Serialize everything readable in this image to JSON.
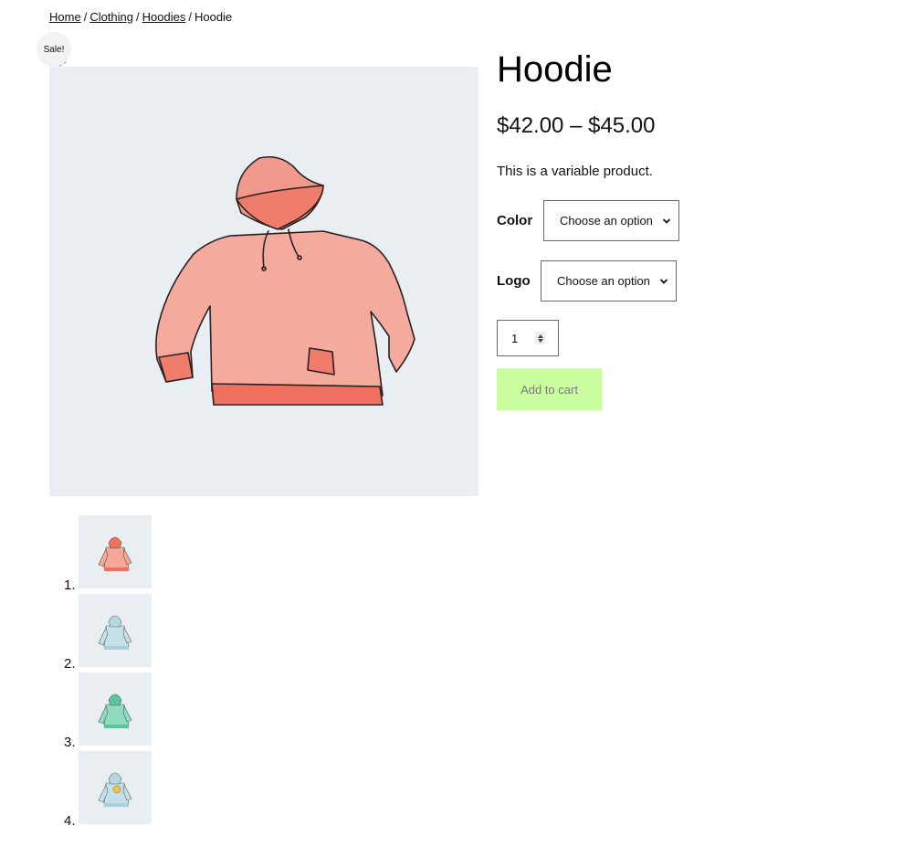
{
  "breadcrumb": {
    "items": [
      {
        "label": "Home",
        "link": true
      },
      {
        "label": "Clothing",
        "link": true
      },
      {
        "label": "Hoodies",
        "link": true
      },
      {
        "label": "Hoodie",
        "link": false
      }
    ],
    "separator": "/"
  },
  "badge": {
    "sale_label": "Sale!"
  },
  "gallery": {
    "main_image": {
      "subject": "hoodie",
      "color": "#f4a79a",
      "background": "#e9eef2"
    },
    "zoom_icon": "magnifier-icon",
    "thumbnails": [
      {
        "number": "1.",
        "variant": "red hoodie",
        "color": "#f4a79a",
        "accent": "#f2705f"
      },
      {
        "number": "2.",
        "variant": "blue hoodie",
        "color": "#c6e0ea",
        "accent": "#a9cfdd"
      },
      {
        "number": "3.",
        "variant": "green hoodie",
        "color": "#8fdcc0",
        "accent": "#5cc39e"
      },
      {
        "number": "4.",
        "variant": "blue hoodie with logo",
        "color": "#c6e0ea",
        "accent": "#a9cfdd",
        "logo_color": "#f2c34a"
      }
    ]
  },
  "product": {
    "title": "Hoodie",
    "price_range": "$42.00 – $45.00",
    "short_description": "This is a variable product.",
    "variations": [
      {
        "label": "Color",
        "selected": "Choose an option"
      },
      {
        "label": "Logo",
        "selected": "Choose an option"
      }
    ],
    "quantity": "1",
    "add_to_cart_label": "Add to cart"
  },
  "colors": {
    "image_bg": "#e9eef2",
    "button_bg": "#c9fd9e",
    "button_text": "#7a7a7a",
    "badge_bg": "#f2f2f2"
  }
}
